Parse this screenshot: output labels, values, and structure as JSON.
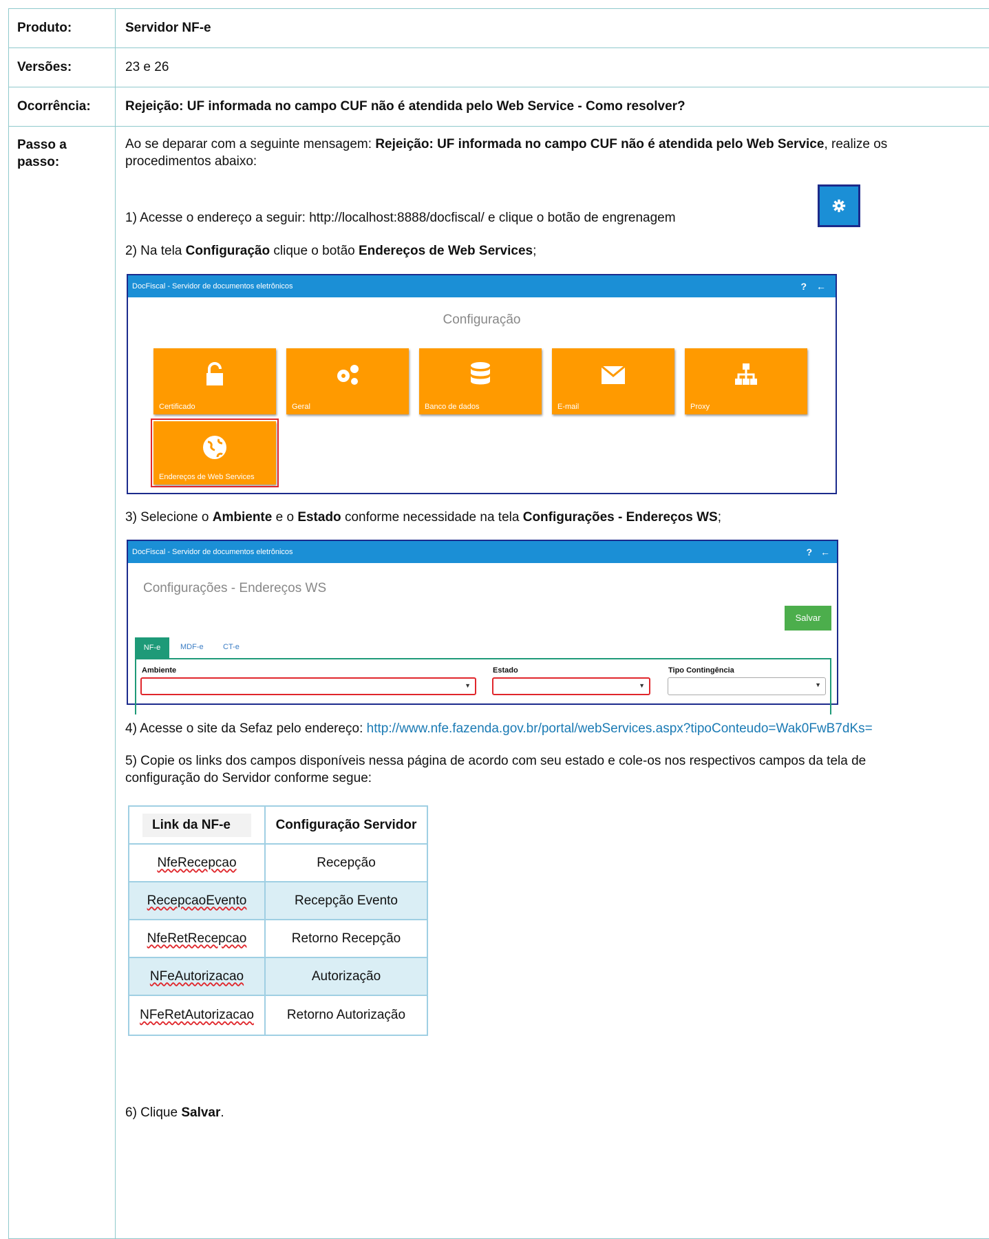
{
  "rows": {
    "produto": {
      "label": "Produto:",
      "value": "Servidor NF-e"
    },
    "versoes": {
      "label": "Versões:",
      "value": "23 e 26"
    },
    "ocorrencia": {
      "label": "Ocorrência:",
      "value": "Rejeição: UF informada no campo CUF não é atendida pelo Web Service - Como resolver?"
    },
    "passo": {
      "label": "Passo a passo:"
    }
  },
  "steps": {
    "intro_a": "Ao se deparar com a seguinte mensagem: ",
    "intro_b": "Rejeição: UF informada no campo CUF não é atendida pelo Web Service",
    "intro_c": ", realize os",
    "intro_d": "procedimentos abaixo:",
    "s1": "1) Acesse o endereço a seguir: http://localhost:8888/docfiscal/ e clique o botão de engrenagem",
    "s2_a": "2) Na tela ",
    "s2_b": "Configuração",
    "s2_c": " clique o botão ",
    "s2_d": "Endereços de Web Services",
    "s2_e": ";",
    "s3_a": "3)  Selecione o ",
    "s3_b": "Ambiente",
    "s3_c": "  e o ",
    "s3_d": "Estado",
    "s3_e": " conforme necessidade na tela ",
    "s3_f": "Configurações - Endereços WS",
    "s3_g": ";",
    "s4_a": "4) Acesse o site da Sefaz pelo endereço: ",
    "s4_link": "http://www.nfe.fazenda.gov.br/portal/webServices.aspx?tipoConteudo=Wak0FwB7dKs=",
    "s5_a": "5) Copie os links dos campos disponíveis nessa página de acordo com seu estado e cole-os nos respectivos campos da tela de",
    "s5_b": "configuração do Servidor conforme segue:",
    "s6_a": "6) Clique ",
    "s6_b": "Salvar",
    "s6_c": "."
  },
  "shot1": {
    "app_title": "DocFiscal - Servidor de documentos eletrônicos",
    "heading": "Configuração",
    "tiles": [
      "Certificado",
      "Geral",
      "Banco de dados",
      "E-mail",
      "Proxy",
      "Endereços de Web Services"
    ]
  },
  "shot2": {
    "app_title": "DocFiscal - Servidor de documentos eletrônicos",
    "heading": "Configurações - Endereços WS",
    "save": "Salvar",
    "tabs": [
      "NF-e",
      "MDF-e",
      "CT-e"
    ],
    "fields": [
      "Ambiente",
      "Estado",
      "Tipo Contingência"
    ]
  },
  "map_table": {
    "headers": [
      "Link da NF-e",
      "Configuração Servidor"
    ],
    "rows": [
      [
        "NfeRecepcao",
        "Recepção"
      ],
      [
        "RecepcaoEvento",
        "Recepção Evento"
      ],
      [
        "NfeRetRecepcao",
        "Retorno Recepção"
      ],
      [
        "NFeAutorizacao",
        "Autorização"
      ],
      [
        "NFeRetAutorizacao",
        "Retorno Autorização"
      ]
    ]
  },
  "colors": {
    "border": "#8fc9cc",
    "tile": "#ff9a00",
    "bar": "#1b8fd6",
    "save": "#4cae4c",
    "tab_active": "#1e9a78"
  }
}
